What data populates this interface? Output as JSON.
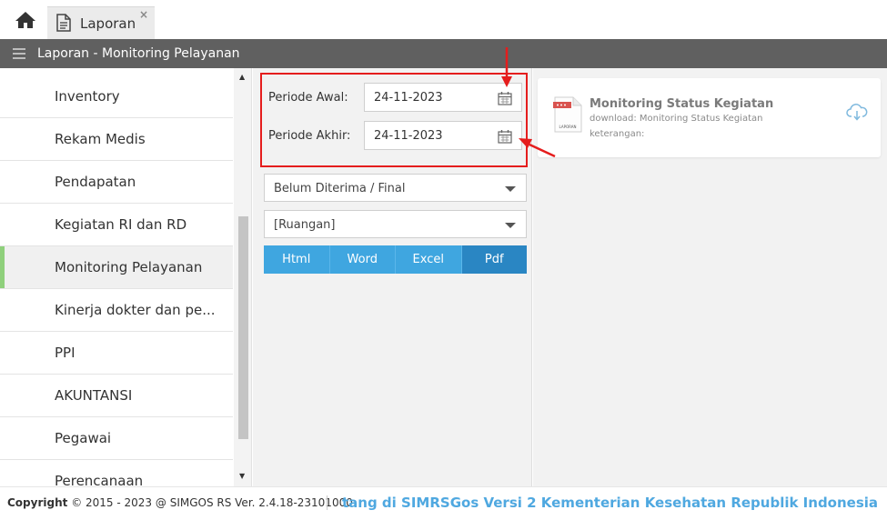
{
  "tabs": {
    "home_icon": "home-icon",
    "active_tab_label": "Laporan",
    "close_glyph": "×"
  },
  "titlebar": {
    "title": "Laporan - Monitoring Pelayanan"
  },
  "sidebar": {
    "items": [
      {
        "label": "Inventory",
        "active": false
      },
      {
        "label": "Rekam Medis",
        "active": false
      },
      {
        "label": "Pendapatan",
        "active": false
      },
      {
        "label": "Kegiatan RI dan RD",
        "active": false
      },
      {
        "label": "Monitoring Pelayanan",
        "active": true
      },
      {
        "label": "Kinerja dokter dan pe...",
        "active": false
      },
      {
        "label": "PPI",
        "active": false
      },
      {
        "label": "AKUNTANSI",
        "active": false
      },
      {
        "label": "Pegawai",
        "active": false
      },
      {
        "label": "Perencanaan",
        "active": false
      }
    ],
    "active_color": "#8fd07c"
  },
  "form": {
    "periode_awal_label": "Periode Awal:",
    "periode_awal_value": "24-11-2023",
    "periode_akhir_label": "Periode Akhir:",
    "periode_akhir_value": "24-11-2023",
    "status_select": "Belum Diterima / Final",
    "ruangan_select": "[Ruangan]",
    "format_buttons": [
      "Html",
      "Word",
      "Excel",
      "Pdf"
    ],
    "selected_format": "Pdf"
  },
  "report_card": {
    "title": "Monitoring Status Kegiatan",
    "download": "download: Monitoring Status Kegiatan",
    "note": "keterangan:",
    "file_label": "LAPORAN"
  },
  "footer": {
    "copyright_label": "Copyright",
    "copyright_rest": "2015 - 2023 @ SIMGOS RS Ver. 2.4.18-23101000",
    "marquee": "tang di SIMRSGos Versi 2 Kementerian Kesehatan Republik Indonesia"
  },
  "colors": {
    "accent_blue": "#3fa6e0",
    "pressed_blue": "#2a86c3",
    "annotation_red": "#e51d1d",
    "titlebar_gray": "#606060"
  }
}
